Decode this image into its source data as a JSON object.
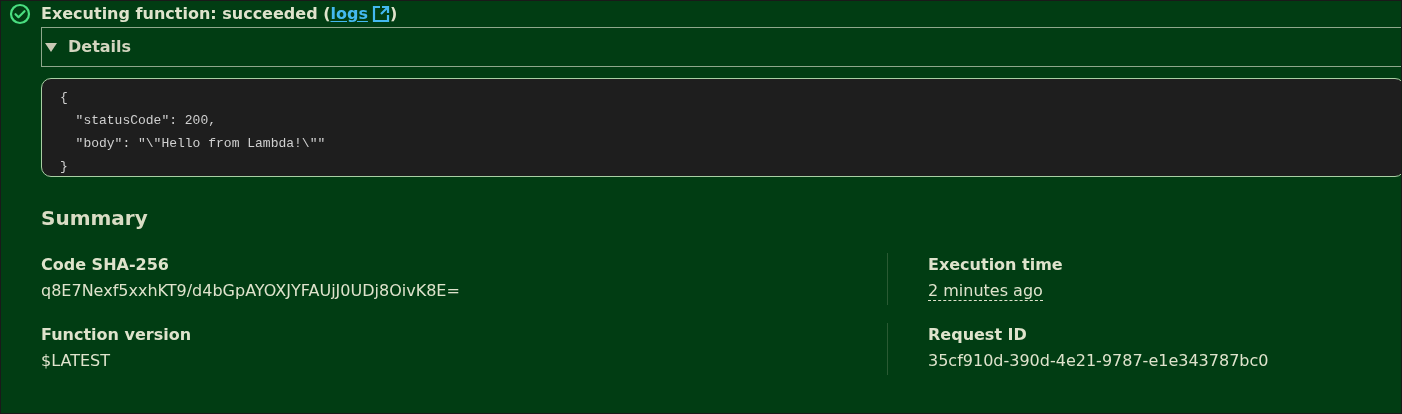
{
  "status": {
    "kind": "success",
    "text_before": "Executing function: succeeded (",
    "link": "logs",
    "text_after": ")"
  },
  "details": {
    "label": "Details",
    "expanded": true,
    "code_lines": [
      "{",
      "  \"statusCode\": 200,",
      "  \"body\": \"\\\"Hello from Lambda!\\\"\"",
      "}"
    ]
  },
  "summary": {
    "title": "Summary",
    "items": [
      {
        "label": "Code SHA-256",
        "value": "q8E7Nexf5xxhKT9/d4bGpAYOXJYFAUjJ0UDj8OivK8E=",
        "kind": "text"
      },
      {
        "label": "Execution time",
        "value": "2 minutes ago",
        "kind": "relative_time"
      },
      {
        "label": "Function version",
        "value": "$LATEST",
        "kind": "text"
      },
      {
        "label": "Request ID",
        "value": "35cf910d-390d-4e21-9787-e1e343787bc0",
        "kind": "text"
      }
    ]
  }
}
